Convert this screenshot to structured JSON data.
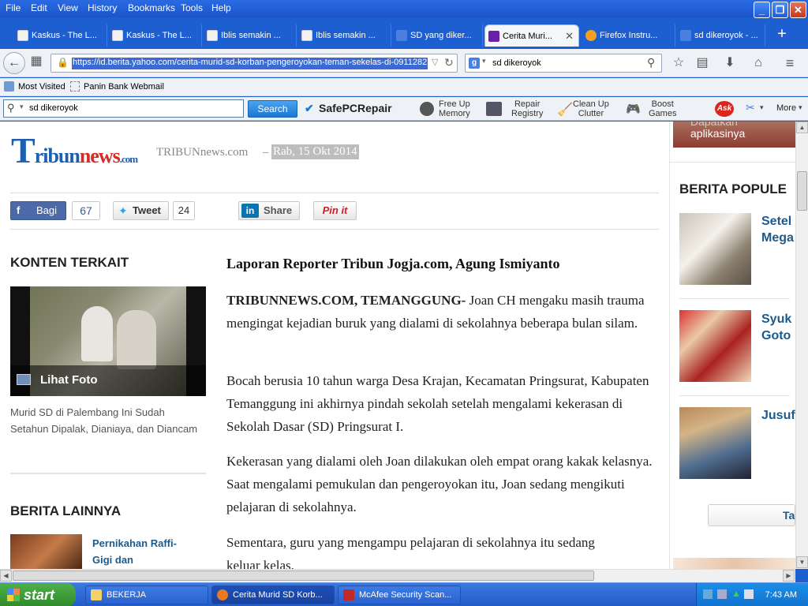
{
  "menu": {
    "file": "File",
    "edit": "Edit",
    "view": "View",
    "history": "History",
    "bookmarks": "Bookmarks",
    "tools": "Tools",
    "help": "Help"
  },
  "window_buttons": {
    "minimize": "_",
    "restore": "❐",
    "close": "✕"
  },
  "tabs": [
    {
      "label": "Kaskus - The L..."
    },
    {
      "label": "Kaskus - The L..."
    },
    {
      "label": "Iblis semakin ..."
    },
    {
      "label": "Iblis semakin ..."
    },
    {
      "label": "SD yang diker..."
    },
    {
      "label": "Cerita Muri..."
    },
    {
      "label": "Firefox Instru..."
    },
    {
      "label": "sd dikeroyok - ..."
    }
  ],
  "new_tab": "+",
  "url": "https://id.berita.yahoo.com/cerita-murid-sd-korban-pengeroyokan-teman-sekelas-di-0911282",
  "search_engine_query": "sd dikeroyok",
  "bookmarks": {
    "most_visited": "Most Visited",
    "panin": "Panin Bank Webmail"
  },
  "toolbar": {
    "query": "sd dikeroyok",
    "search": "Search",
    "safepc": "SafePCRepair",
    "free_up_1": "Free Up",
    "free_up_2": "Memory",
    "repair_1": "Repair",
    "repair_2": "Registry",
    "clean_1": "Clean Up",
    "clean_2": "Clutter",
    "boost_1": "Boost",
    "boost_2": "Games",
    "more": "More"
  },
  "article": {
    "brand": "Tribunnews.com",
    "source": "TRIBUNnews.com",
    "dash": "–",
    "date": "Rab, 15 Okt 2014",
    "share": {
      "bagi": "Bagi",
      "bagi_count": "67",
      "tweet": "Tweet",
      "tweet_count": "24",
      "linkedin": "Share",
      "pin": "Pin it"
    },
    "byline": "Laporan Reporter Tribun Jogja.com, Agung Ismiyanto",
    "p1_bold": "TRIBUNNEWS.COM, TEMANGGUNG-",
    "p1_rest": " Joan CH  mengaku masih trauma mengingat kejadian buruk yang dialami di sekolahnya beberapa bulan silam.",
    "p2": "Bocah berusia 10 tahun warga Desa Krajan, Kecamatan Pringsurat, Kabupaten Temanggung ini akhirnya pindah sekolah setelah mengalami kekerasan di Sekolah Dasar (SD) Pringsurat I.",
    "p3": "Kekerasan yang dialami oleh Joan dilakukan oleh empat orang kakak kelasnya. Saat mengalami pemukulan dan pengeroyokan itu, Joan sedang mengikuti pelajaran di sekolahnya.",
    "p4": "Sementara, guru yang mengampu pelajaran di sekolahnya itu sedang keluar kelas."
  },
  "related": {
    "title": "KONTEN TERKAIT",
    "lihat_foto": "Lihat Foto",
    "caption": "Murid SD di Palembang Ini Sudah Setahun Dipalak, Dianiaya, dan Diancam",
    "lainnya_title": "BERITA LAINNYA",
    "lainnya_item": "Pernikahan Raffi-Gigi dan"
  },
  "right": {
    "ad_text": "aplikasinya",
    "ad_text_top": "Dapatkan",
    "populer_title": "BERITA POPULE",
    "items": [
      {
        "line1": "Setel",
        "line2": "Mega"
      },
      {
        "line1": "Syuk",
        "line2": "Goto"
      },
      {
        "line1": "Jusuf",
        "line2": ""
      }
    ],
    "tab_btn": "Ta"
  },
  "taskbar": {
    "start": "start",
    "tasks": [
      {
        "label": "BEKERJA"
      },
      {
        "label": "Cerita Murid SD Korb..."
      },
      {
        "label": "McAfee Security Scan..."
      }
    ],
    "time": "7:43 AM"
  }
}
